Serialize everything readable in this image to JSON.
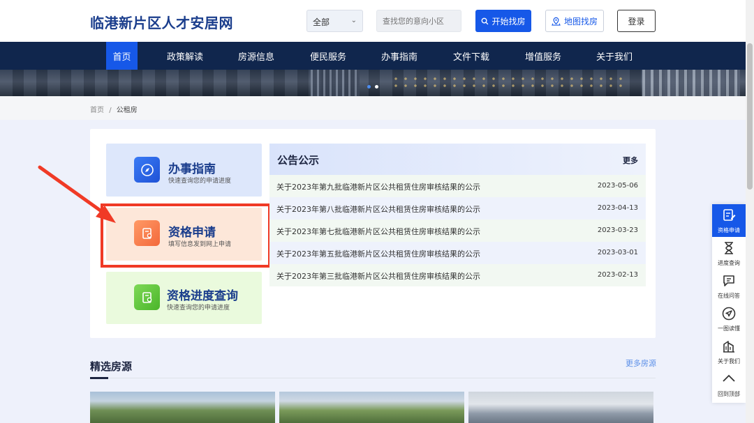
{
  "header": {
    "logo": "临港新片区人才安居网",
    "select_value": "全部",
    "search_placeholder": "查找您的意向小区",
    "find_button": "开始找房",
    "map_button": "地图找房",
    "login_button": "登录"
  },
  "nav": [
    "首页",
    "政策解读",
    "房源信息",
    "便民服务",
    "办事指南",
    "文件下载",
    "增值服务",
    "关于我们"
  ],
  "breadcrumb": {
    "home": "首页",
    "sep": "/",
    "current": "公租房"
  },
  "tiles": [
    {
      "title": "办事指南",
      "sub": "快速查询您的申请进度"
    },
    {
      "title": "资格申请",
      "sub": "填写信息发到网上申请"
    },
    {
      "title": "资格进度查询",
      "sub": "快速查询您的申请进度"
    }
  ],
  "notice": {
    "title": "公告公示",
    "more": "更多",
    "rows": [
      {
        "text": "关于2023年第九批临港新片区公共租赁住房审核结果的公示",
        "date": "2023-05-06"
      },
      {
        "text": "关于2023年第八批临港新片区公共租赁住房审核结果的公示",
        "date": "2023-04-13"
      },
      {
        "text": "关于2023年第七批临港新片区公共租赁住房审核结果的公示",
        "date": "2023-03-23"
      },
      {
        "text": "关于2023年第五批临港新片区公共租赁住房审核结果的公示",
        "date": "2023-03-01"
      },
      {
        "text": "关于2023年第三批临港新片区公共租赁住房审核结果的公示",
        "date": "2023-02-13"
      }
    ]
  },
  "featured": {
    "title": "精选房源",
    "more": "更多房源"
  },
  "float": [
    "资格申请",
    "进度查询",
    "在线问答",
    "一图读懂",
    "关于我们",
    "回到顶部"
  ],
  "colors": {
    "primary": "#1658e8",
    "nav": "#10264d",
    "highlight": "#f03a26"
  }
}
